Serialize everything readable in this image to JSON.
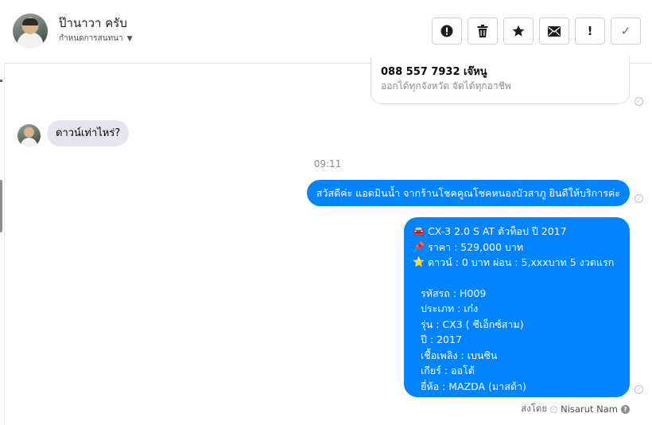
{
  "header": {
    "contact_name": "ป๊านาวา ครับ",
    "assign_label": "กำหนดการสนทนา",
    "actions": [
      {
        "name": "report-spam-button",
        "icon": "exclamation-circle-icon"
      },
      {
        "name": "delete-button",
        "icon": "trash-icon"
      },
      {
        "name": "star-button",
        "icon": "star-icon"
      },
      {
        "name": "mark-unread-button",
        "icon": "envelope-icon"
      },
      {
        "name": "follow-up-button",
        "icon": "exclamation-icon",
        "glyph": "!"
      },
      {
        "name": "mark-done-button",
        "icon": "checkmark-icon",
        "glyph": "✓"
      }
    ]
  },
  "conversation": {
    "previous_card": {
      "line1": "088 557 7932 เจ๊หนู",
      "line2": "ออกได้ทุกจังหวัด จัดได้ทุกอาชีพ"
    },
    "incoming_message": "ดาวน์เท่าไหร่?",
    "timestamp": "09:11",
    "outgoing_greeting": "สวัสดีค่ะ แอดมินน้ำ จากร้านโชคคูณโชคหนองบัวสาภู ยินดีให้บริการค่ะ",
    "car_details": {
      "title_icon": "🚘",
      "title": "CX-3 2.0 S AT ตัวท็อป ปี 2017",
      "price_icon": "📌",
      "price": "ราคา : 529,000 บาท",
      "down_icon": "⭐",
      "down": "ดาวน์ : 0 บาท ผ่อน : 5,xxxบาท 5 งวดแรก",
      "code": "รหัสรถ : H009",
      "type": "ประเภท : เก๋ง",
      "model": "รุ่น : CX3 ( ซีเอ็กซ์สาม)",
      "year": "ปี : 2017",
      "fuel": "เชื้อเพลิง : เบนซิน",
      "gear": "เกียร์ : ออโต้",
      "brand": "ยี่ห้อ : MAZDA (มาสด้า)"
    },
    "sent_by_label": "ส่งโดย",
    "agent_name": "Nisarut Nam",
    "seen_glyph": "✓",
    "help_glyph": "?"
  },
  "colors": {
    "outgoing_bubble": "#0084ff",
    "incoming_bubble": "#e4e6eb",
    "muted_text": "#8a8d91"
  }
}
